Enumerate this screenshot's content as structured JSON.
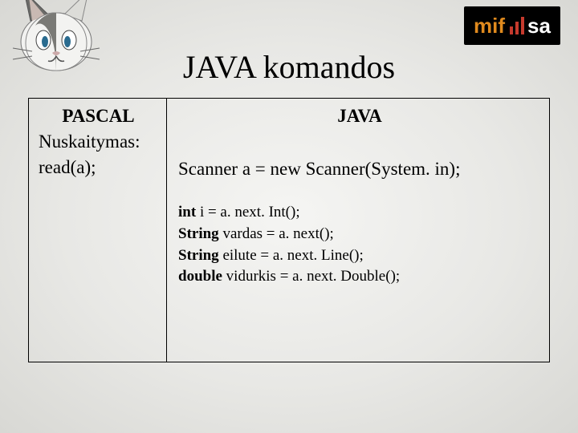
{
  "title": "JAVA komandos",
  "logo": {
    "mif": "mif",
    "sa": "sa"
  },
  "table": {
    "left": {
      "header": "PASCAL",
      "line1": "Nuskaitymas:",
      "line2": "read(a);"
    },
    "right": {
      "header": "JAVA",
      "scanner": "Scanner a = new Scanner(System. in);",
      "lines": [
        {
          "kw": "int",
          "rest": " i = a. next. Int();"
        },
        {
          "kw": "String",
          "rest": " vardas = a. next();"
        },
        {
          "kw": "String",
          "rest": " eilute = a. next. Line();"
        },
        {
          "kw": "double",
          "rest": " vidurkis = a. next. Double();"
        }
      ]
    }
  }
}
